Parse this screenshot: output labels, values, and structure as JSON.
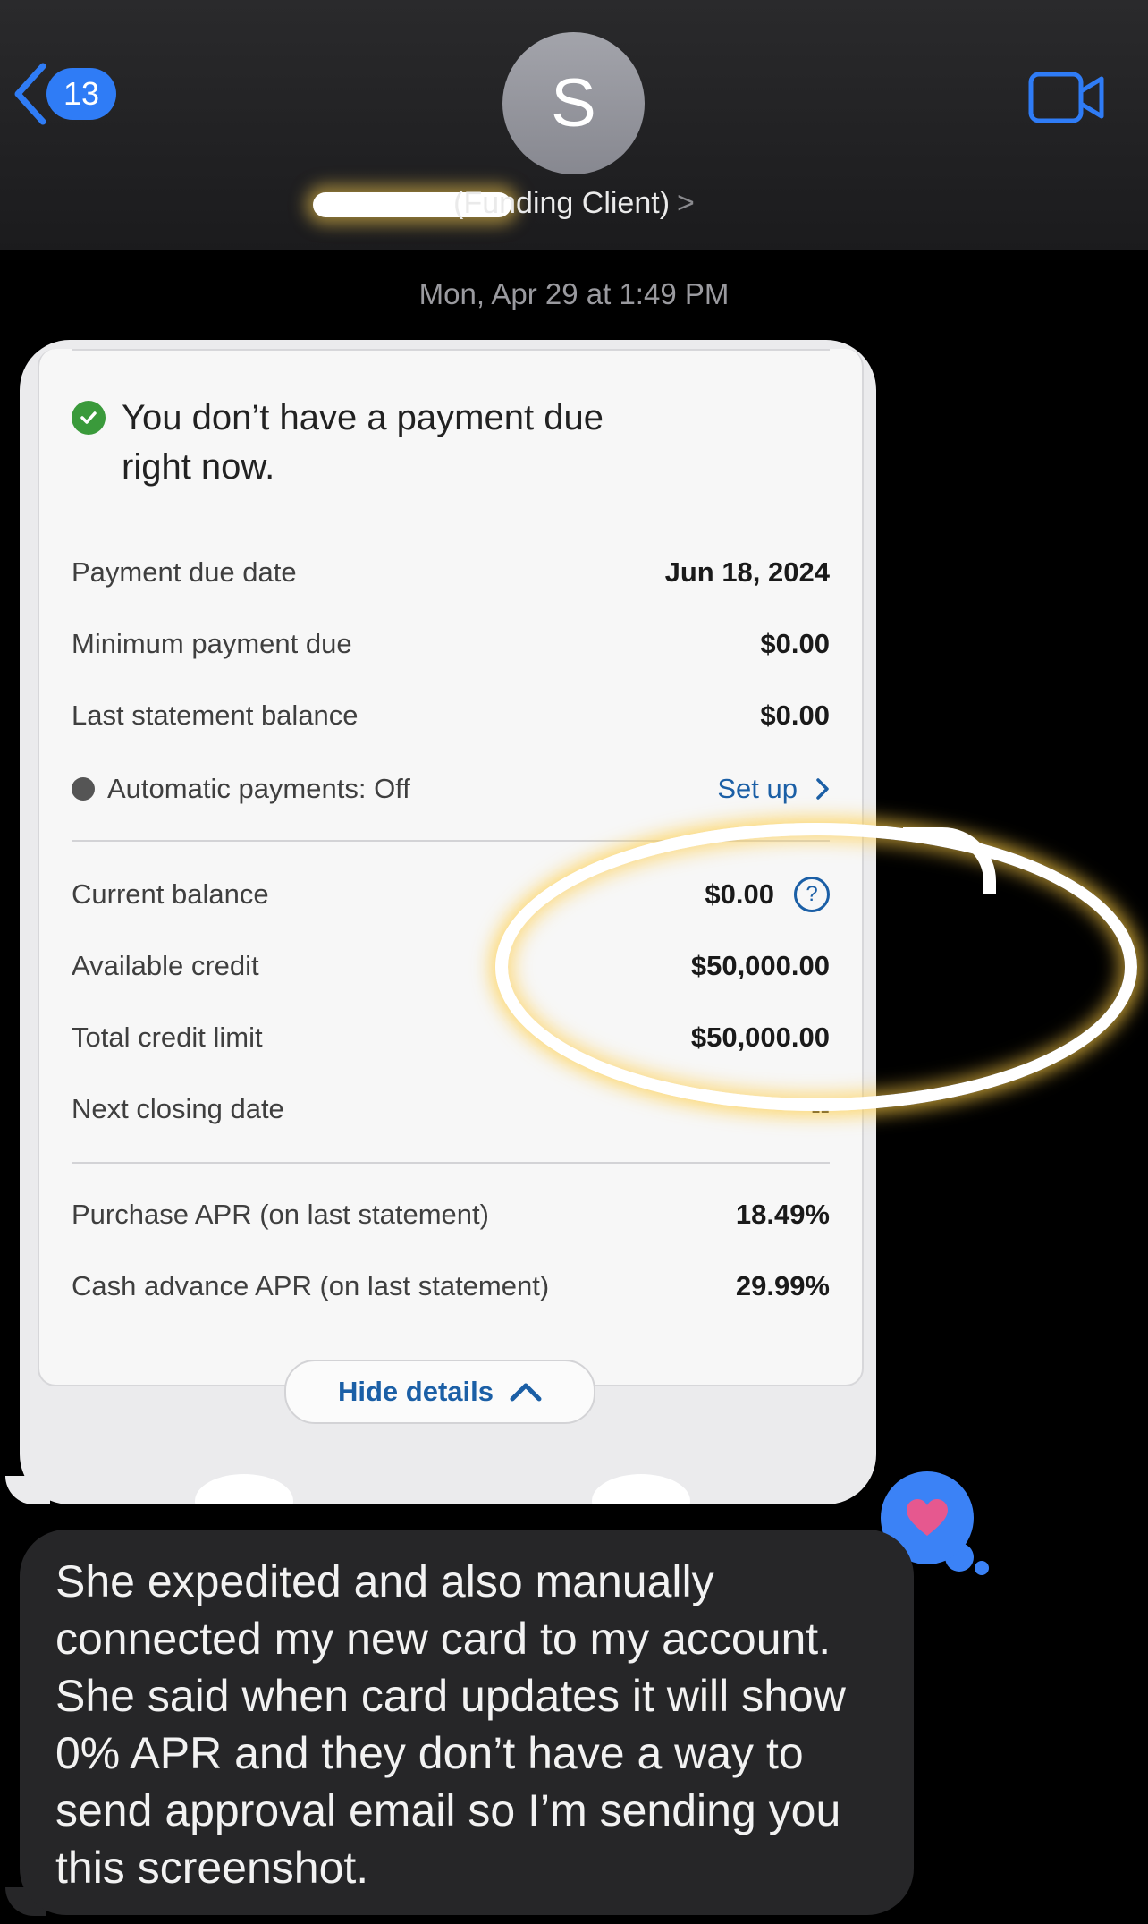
{
  "header": {
    "back_count": "13",
    "avatar_initial": "S",
    "contact_name": "(Funding Client)",
    "contact_chevron": ">"
  },
  "thread": {
    "timestamp": "Mon, Apr 29 at 1:49 PM"
  },
  "screenshot": {
    "notice": "You don’t have a payment due right now.",
    "rows": [
      {
        "label": "Payment due date",
        "value": "Jun 18, 2024"
      },
      {
        "label": "Minimum payment due",
        "value": "$0.00"
      },
      {
        "label": "Last statement balance",
        "value": "$0.00"
      },
      {
        "label": "Automatic payments: Off",
        "value": "Set up"
      },
      {
        "label": "Current balance",
        "value": "$0.00"
      },
      {
        "label": "Available credit",
        "value": "$50,000.00"
      },
      {
        "label": "Total credit limit",
        "value": "$50,000.00"
      },
      {
        "label": "Next closing date",
        "value": "--"
      },
      {
        "label": "Purchase APR (on last statement)",
        "value": "18.49%"
      },
      {
        "label": "Cash advance APR (on last statement)",
        "value": "29.99%"
      }
    ],
    "help_glyph": "?",
    "hide_details": "Hide details"
  },
  "message": {
    "text": "She expedited and also manually connected my new card to my account. She said when card updates it will show 0% APR and they don’t have a way to send approval email so I’m sending you this screenshot."
  },
  "colors": {
    "accent": "#2f7cf6",
    "link": "#1b5fa6",
    "heart": "#e6588f"
  },
  "icons": [
    "back-chevron-icon",
    "video-call-icon",
    "checkmark-icon",
    "help-icon",
    "chevron-right-icon",
    "chevron-up-icon",
    "heart-icon"
  ]
}
